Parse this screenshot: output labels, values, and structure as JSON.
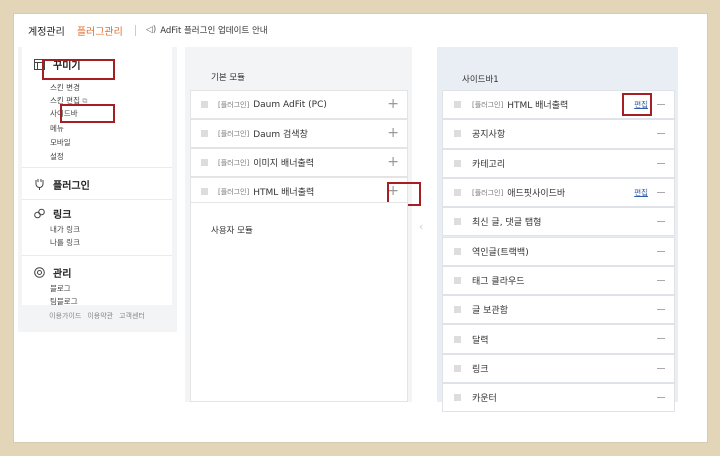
{
  "topbar": {
    "account": "계정관리",
    "plugin": "플러그관리",
    "notice": "AdFit 플러그인 업데이트 안내",
    "notice_icon": "speaker-icon"
  },
  "left_menu": {
    "sections": [
      {
        "title": "꾸미기",
        "icon": "layout-icon",
        "items": [
          "스킨 변경",
          "스킨 편집",
          "사이드바",
          "메뉴",
          "모바일",
          "설정"
        ]
      },
      {
        "title": "플러그인",
        "icon": "plugin-icon",
        "items": []
      },
      {
        "title": "링크",
        "icon": "link-icon",
        "items": [
          "내가 링크",
          "나를 링크"
        ]
      },
      {
        "title": "관리",
        "icon": "settings-icon",
        "items": [
          "블로그",
          "팀블로그"
        ]
      }
    ],
    "footer": [
      "이용가이드",
      "이용약관",
      "고객센터"
    ],
    "external_icon": "⧉"
  },
  "basic_modules": {
    "title": "기본 모듈",
    "rows": [
      {
        "tag": "[플러그인]",
        "label": "Daum AdFit (PC)"
      },
      {
        "tag": "[플러그인]",
        "label": "Daum 검색창"
      },
      {
        "tag": "[플러그인]",
        "label": "이미지 배너출력"
      },
      {
        "tag": "[플러그인]",
        "label": "HTML 배너출력"
      }
    ],
    "plus": "+"
  },
  "user_modules": {
    "title": "사용자 모듈"
  },
  "sidebar1": {
    "title": "사이드바1",
    "edit_label": "편집",
    "rows": [
      {
        "tag": "[플러그인]",
        "label": "HTML 배너출력",
        "editable": true
      },
      {
        "tag": "",
        "label": "공지사항",
        "editable": false
      },
      {
        "tag": "",
        "label": "카테고리",
        "editable": false
      },
      {
        "tag": "[플러그인]",
        "label": "애드핏사이드바",
        "editable": true
      },
      {
        "tag": "",
        "label": "최신 글, 댓글 탭형",
        "editable": false
      },
      {
        "tag": "",
        "label": "역인글(트랙백)",
        "editable": false
      },
      {
        "tag": "",
        "label": "태그 클라우드",
        "editable": false
      },
      {
        "tag": "",
        "label": "글 보관함",
        "editable": false
      },
      {
        "tag": "",
        "label": "달력",
        "editable": false
      },
      {
        "tag": "",
        "label": "링크",
        "editable": false
      },
      {
        "tag": "",
        "label": "카운터",
        "editable": false
      }
    ]
  },
  "colors": {
    "accent": "#e06c2b",
    "highlight": "#a51e23",
    "link": "#2f5ea8"
  }
}
